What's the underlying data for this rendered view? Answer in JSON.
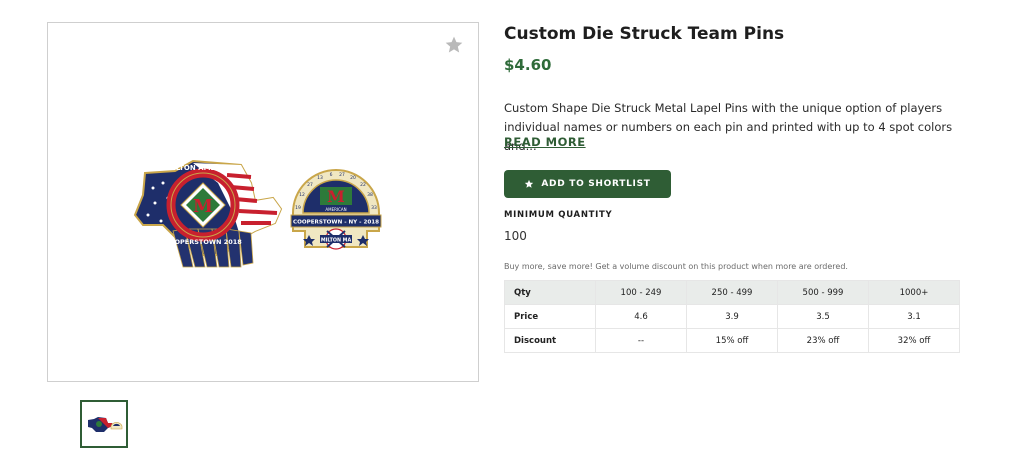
{
  "product": {
    "title": "Custom Die Struck Team Pins",
    "price": "$4.60",
    "description": "Custom Shape Die Struck Metal Lapel Pins with the unique option of players individual names or numbers on each pin and printed with up to 4 spot colors and...",
    "read_more_label": "READ MORE",
    "shortlist_label": "ADD TO SHORTLIST",
    "min_qty_label": "MINIMUM QUANTITY",
    "min_qty_value": "100",
    "volume_note": "Buy more, save more! Get a volume discount on this product when more are ordered."
  },
  "pins": {
    "left_arc_text": "MILTON AMERICAN",
    "left_bottom_text": "COOPERSTOWN 2018",
    "logo_letter": "M",
    "right_small_text": "AMERICAN",
    "right_band_text": "COOPERSTOWN - NY - 2018",
    "right_bottom_text": "MILTON MA"
  },
  "icons": {
    "favorite": "star-icon",
    "shortlist": "star-icon"
  },
  "colors": {
    "brand_green": "#2f5d35",
    "price_green": "#2f6b3a",
    "table_header_bg": "#e9ecea"
  },
  "pricing_table": {
    "header": [
      "Qty",
      "100 - 249",
      "250 - 499",
      "500 - 999",
      "1000+"
    ],
    "rows": [
      [
        "Price",
        "4.6",
        "3.9",
        "3.5",
        "3.1"
      ],
      [
        "Discount",
        "--",
        "15% off",
        "23% off",
        "32% off"
      ]
    ]
  }
}
